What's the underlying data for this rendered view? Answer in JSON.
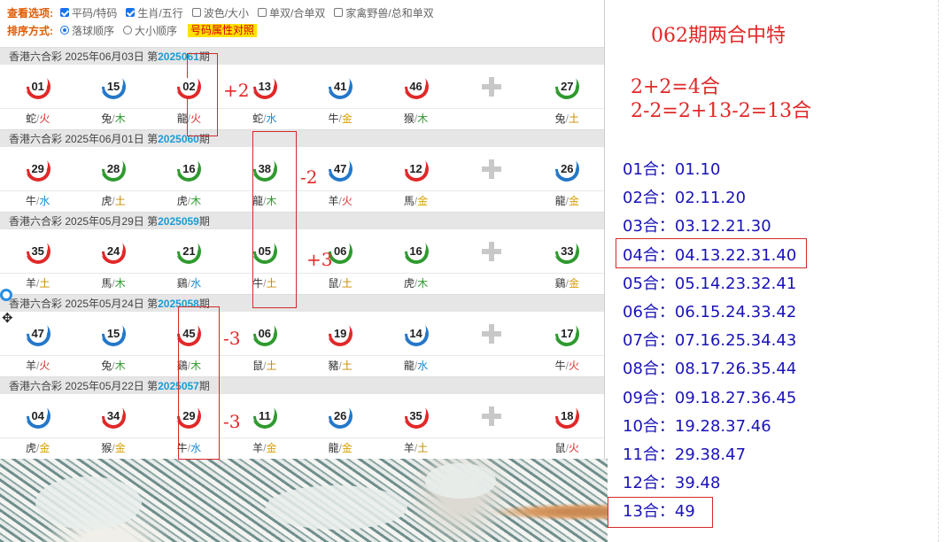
{
  "options": {
    "view_label": "查看选项:",
    "checks": [
      {
        "label": "平码/特码",
        "checked": true
      },
      {
        "label": "生肖/五行",
        "checked": true
      },
      {
        "label": "波色/大小",
        "checked": false
      },
      {
        "label": "单双/合单双",
        "checked": false
      },
      {
        "label": "家禽野兽/总和单双",
        "checked": false
      }
    ],
    "sort_label": "排序方式:",
    "sort": [
      {
        "label": "落球顺序",
        "checked": true
      },
      {
        "label": "大小顺序",
        "checked": false
      }
    ],
    "attr_button": "号码属性对照"
  },
  "draws": [
    {
      "lottery": "香港六合彩",
      "date": "2025年06月03日",
      "prefix": "第",
      "period": "2025061",
      "suffix": "期",
      "balls": [
        {
          "n": "01",
          "color": "red",
          "zodiac": "蛇",
          "element": "火"
        },
        {
          "n": "15",
          "color": "blue",
          "zodiac": "兔",
          "element": "木"
        },
        {
          "n": "02",
          "color": "red",
          "zodiac": "龍",
          "element": "火"
        },
        {
          "n": "13",
          "color": "red",
          "zodiac": "蛇",
          "element": "水"
        },
        {
          "n": "41",
          "color": "blue",
          "zodiac": "牛",
          "element": "金"
        },
        {
          "n": "46",
          "color": "red",
          "zodiac": "猴",
          "element": "木"
        },
        {
          "n": "27",
          "color": "green",
          "zodiac": "兔",
          "element": "土"
        }
      ]
    },
    {
      "lottery": "香港六合彩",
      "date": "2025年06月01日",
      "prefix": "第",
      "period": "2025060",
      "suffix": "期",
      "balls": [
        {
          "n": "29",
          "color": "red",
          "zodiac": "牛",
          "element": "水"
        },
        {
          "n": "28",
          "color": "green",
          "zodiac": "虎",
          "element": "土"
        },
        {
          "n": "16",
          "color": "green",
          "zodiac": "虎",
          "element": "木"
        },
        {
          "n": "38",
          "color": "green",
          "zodiac": "龍",
          "element": "木"
        },
        {
          "n": "47",
          "color": "blue",
          "zodiac": "羊",
          "element": "火"
        },
        {
          "n": "12",
          "color": "red",
          "zodiac": "馬",
          "element": "金"
        },
        {
          "n": "26",
          "color": "blue",
          "zodiac": "龍",
          "element": "金"
        }
      ]
    },
    {
      "lottery": "香港六合彩",
      "date": "2025年05月29日",
      "prefix": "第",
      "period": "2025059",
      "suffix": "期",
      "balls": [
        {
          "n": "35",
          "color": "red",
          "zodiac": "羊",
          "element": "土"
        },
        {
          "n": "24",
          "color": "red",
          "zodiac": "馬",
          "element": "木"
        },
        {
          "n": "21",
          "color": "green",
          "zodiac": "鷄",
          "element": "水"
        },
        {
          "n": "05",
          "color": "green",
          "zodiac": "牛",
          "element": "土"
        },
        {
          "n": "06",
          "color": "green",
          "zodiac": "鼠",
          "element": "土"
        },
        {
          "n": "16",
          "color": "green",
          "zodiac": "虎",
          "element": "木"
        },
        {
          "n": "33",
          "color": "green",
          "zodiac": "鷄",
          "element": "金"
        }
      ]
    },
    {
      "lottery": "香港六合彩",
      "date": "2025年05月24日",
      "prefix": "第",
      "period": "2025058",
      "suffix": "期",
      "balls": [
        {
          "n": "47",
          "color": "blue",
          "zodiac": "羊",
          "element": "火"
        },
        {
          "n": "15",
          "color": "blue",
          "zodiac": "兔",
          "element": "木"
        },
        {
          "n": "45",
          "color": "red",
          "zodiac": "鷄",
          "element": "木"
        },
        {
          "n": "06",
          "color": "green",
          "zodiac": "鼠",
          "element": "土"
        },
        {
          "n": "19",
          "color": "red",
          "zodiac": "豬",
          "element": "土"
        },
        {
          "n": "14",
          "color": "blue",
          "zodiac": "龍",
          "element": "水"
        },
        {
          "n": "17",
          "color": "green",
          "zodiac": "牛",
          "element": "火"
        }
      ]
    },
    {
      "lottery": "香港六合彩",
      "date": "2025年05月22日",
      "prefix": "第",
      "period": "2025057",
      "suffix": "期",
      "balls": [
        {
          "n": "04",
          "color": "blue",
          "zodiac": "虎",
          "element": "金"
        },
        {
          "n": "34",
          "color": "red",
          "zodiac": "猴",
          "element": "金"
        },
        {
          "n": "29",
          "color": "red",
          "zodiac": "牛",
          "element": "水"
        },
        {
          "n": "11",
          "color": "green",
          "zodiac": "羊",
          "element": "金"
        },
        {
          "n": "26",
          "color": "blue",
          "zodiac": "龍",
          "element": "金"
        },
        {
          "n": "35",
          "color": "red",
          "zodiac": "羊",
          "element": "土"
        },
        {
          "n": "18",
          "color": "red",
          "zodiac": "鼠",
          "element": "火"
        }
      ]
    }
  ],
  "annotations": [
    "+2",
    "-2",
    "+3",
    "-3",
    "-3"
  ],
  "notes": {
    "title": "062期两合中特",
    "formula1": "2+2=4合",
    "formula2": "2-2=2+13-2=13合",
    "he_list": [
      "01合：01.10",
      "02合：02.11.20",
      "03合：03.12.21.30",
      "04合：04.13.22.31.40",
      "05合：05.14.23.32.41",
      "06合：06.15.24.33.42",
      "07合：07.16.25.34.43",
      "08合：08.17.26.35.44",
      "09合：09.18.27.36.45",
      "10合：19.28.37.46",
      "11合：29.38.47",
      "12合：39.48",
      "13合：49"
    ]
  },
  "colors": {
    "red": "#e12828",
    "blue": "#2477c9",
    "green": "#2f9a2f",
    "annotation": "#e12828",
    "list_text": "#1a13b8"
  }
}
